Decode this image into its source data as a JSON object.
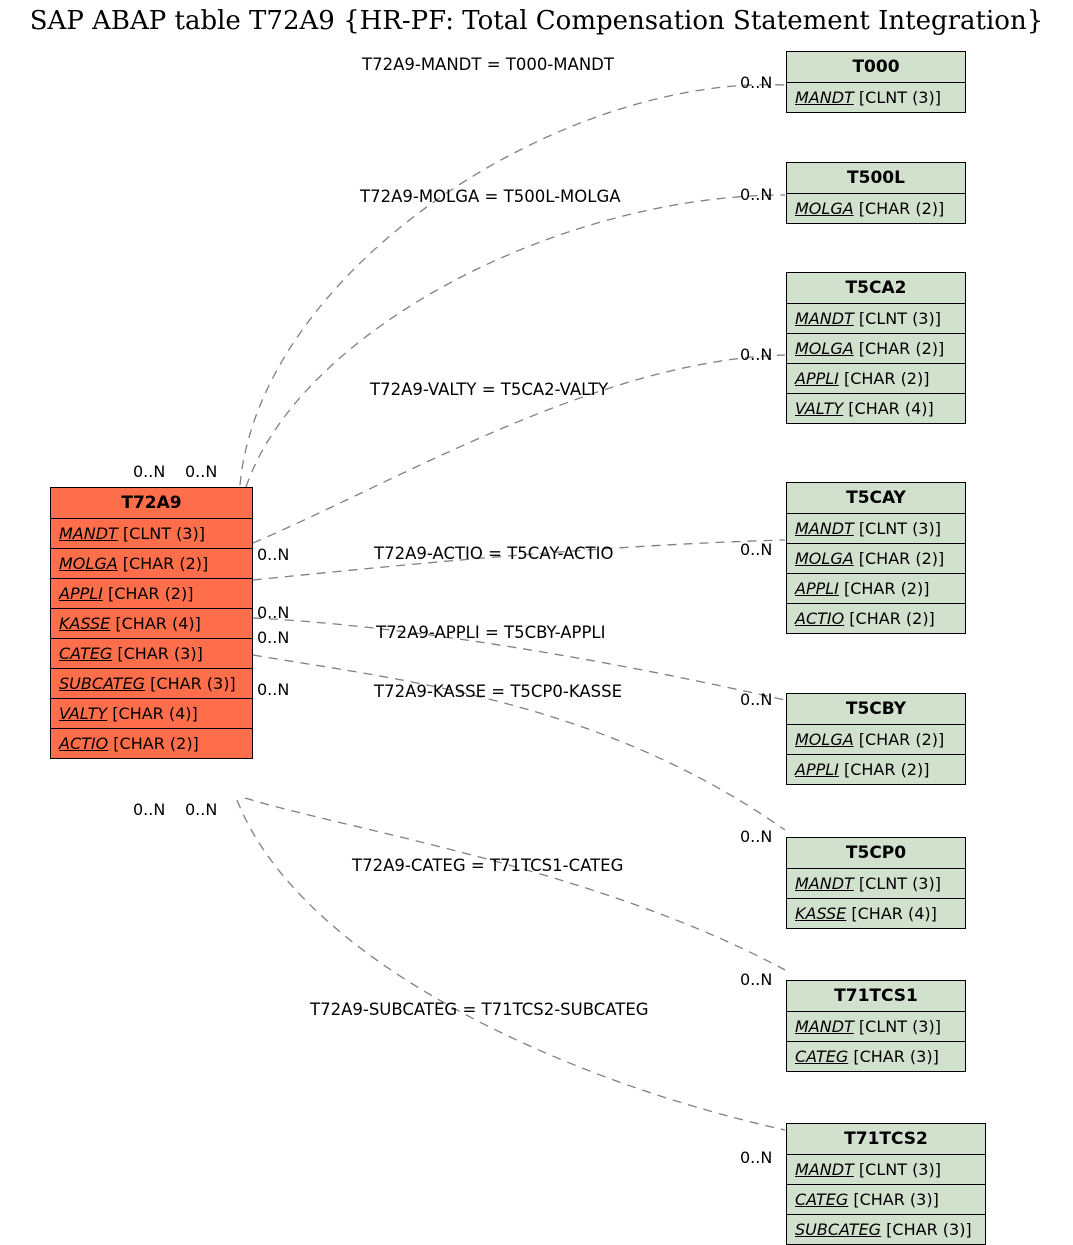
{
  "title": "SAP ABAP table T72A9 {HR-PF: Total Compensation Statement Integration}",
  "main": {
    "name": "T72A9",
    "fields": [
      {
        "name": "MANDT",
        "type": "[CLNT (3)]"
      },
      {
        "name": "MOLGA",
        "type": "[CHAR (2)]"
      },
      {
        "name": "APPLI",
        "type": "[CHAR (2)]"
      },
      {
        "name": "KASSE",
        "type": "[CHAR (4)]"
      },
      {
        "name": "CATEG",
        "type": "[CHAR (3)]"
      },
      {
        "name": "SUBCATEG",
        "type": "[CHAR (3)]"
      },
      {
        "name": "VALTY",
        "type": "[CHAR (4)]"
      },
      {
        "name": "ACTIO",
        "type": "[CHAR (2)]"
      }
    ]
  },
  "refs": {
    "t000": {
      "name": "T000",
      "fields": [
        {
          "name": "MANDT",
          "type": "[CLNT (3)]"
        }
      ]
    },
    "t500l": {
      "name": "T500L",
      "fields": [
        {
          "name": "MOLGA",
          "type": "[CHAR (2)]"
        }
      ]
    },
    "t5ca2": {
      "name": "T5CA2",
      "fields": [
        {
          "name": "MANDT",
          "type": "[CLNT (3)]"
        },
        {
          "name": "MOLGA",
          "type": "[CHAR (2)]"
        },
        {
          "name": "APPLI",
          "type": "[CHAR (2)]"
        },
        {
          "name": "VALTY",
          "type": "[CHAR (4)]"
        }
      ]
    },
    "t5cay": {
      "name": "T5CAY",
      "fields": [
        {
          "name": "MANDT",
          "type": "[CLNT (3)]"
        },
        {
          "name": "MOLGA",
          "type": "[CHAR (2)]"
        },
        {
          "name": "APPLI",
          "type": "[CHAR (2)]"
        },
        {
          "name": "ACTIO",
          "type": "[CHAR (2)]"
        }
      ]
    },
    "t5cby": {
      "name": "T5CBY",
      "fields": [
        {
          "name": "MOLGA",
          "type": "[CHAR (2)]"
        },
        {
          "name": "APPLI",
          "type": "[CHAR (2)]"
        }
      ]
    },
    "t5cp0": {
      "name": "T5CP0",
      "fields": [
        {
          "name": "MANDT",
          "type": "[CLNT (3)]"
        },
        {
          "name": "KASSE",
          "type": "[CHAR (4)]"
        }
      ]
    },
    "t71tcs1": {
      "name": "T71TCS1",
      "fields": [
        {
          "name": "MANDT",
          "type": "[CLNT (3)]"
        },
        {
          "name": "CATEG",
          "type": "[CHAR (3)]"
        }
      ]
    },
    "t71tcs2": {
      "name": "T71TCS2",
      "fields": [
        {
          "name": "MANDT",
          "type": "[CLNT (3)]"
        },
        {
          "name": "CATEG",
          "type": "[CHAR (3)]"
        },
        {
          "name": "SUBCATEG",
          "type": "[CHAR (3)]"
        }
      ]
    }
  },
  "edges": {
    "e1": "T72A9-MANDT = T000-MANDT",
    "e2": "T72A9-MOLGA = T500L-MOLGA",
    "e3": "T72A9-VALTY = T5CA2-VALTY",
    "e4": "T72A9-ACTIO = T5CAY-ACTIO",
    "e5": "T72A9-APPLI = T5CBY-APPLI",
    "e6": "T72A9-KASSE = T5CP0-KASSE",
    "e7": "T72A9-CATEG = T71TCS1-CATEG",
    "e8": "T72A9-SUBCATEG = T71TCS2-SUBCATEG"
  },
  "card": "0..N"
}
